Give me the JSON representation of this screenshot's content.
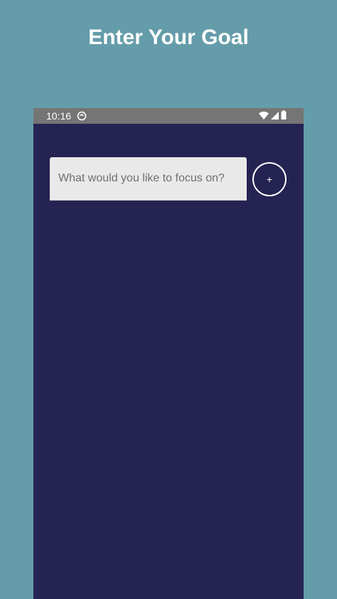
{
  "promo": {
    "title": "Enter Your Goal"
  },
  "status_bar": {
    "time": "10:16",
    "icons": [
      "notification-icon",
      "wifi-icon",
      "cell-signal-icon",
      "battery-icon"
    ]
  },
  "goal_form": {
    "placeholder": "What would you like to focus on?",
    "value": "",
    "add_label": "+"
  },
  "colors": {
    "page_background": "#659ca9",
    "app_background": "#252352",
    "status_bar": "#757575",
    "input_background": "#e9e9e9"
  }
}
